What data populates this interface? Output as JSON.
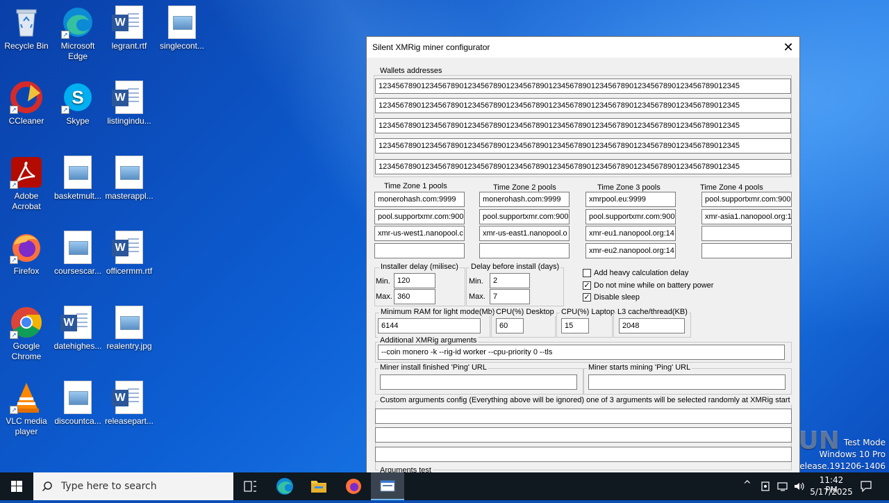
{
  "desktop_icons": [
    {
      "label": "Recycle Bin",
      "icon": "recycle-bin-icon"
    },
    {
      "label": "Microsoft Edge",
      "icon": "edge-icon"
    },
    {
      "label": "legrant.rtf",
      "icon": "word-doc-icon"
    },
    {
      "label": "singlecont...",
      "icon": "image-file-icon"
    },
    {
      "label": "CCleaner",
      "icon": "ccleaner-icon"
    },
    {
      "label": "Skype",
      "icon": "skype-icon"
    },
    {
      "label": "listingindu...",
      "icon": "word-doc-icon"
    },
    {
      "label": "Adobe Acrobat",
      "icon": "acrobat-icon"
    },
    {
      "label": "basketmult...",
      "icon": "image-file-icon"
    },
    {
      "label": "masterappl...",
      "icon": "image-file-icon"
    },
    {
      "label": "Firefox",
      "icon": "firefox-icon"
    },
    {
      "label": "coursescar...",
      "icon": "image-file-icon"
    },
    {
      "label": "officermm.rtf",
      "icon": "word-doc-icon"
    },
    {
      "label": "Google Chrome",
      "icon": "chrome-icon"
    },
    {
      "label": "datehighes...",
      "icon": "word-doc-icon"
    },
    {
      "label": "realentry.jpg",
      "icon": "image-file-icon"
    },
    {
      "label": "VLC media player",
      "icon": "vlc-icon"
    },
    {
      "label": "discountca...",
      "icon": "image-file-icon"
    },
    {
      "label": "releasepart...",
      "icon": "word-doc-icon"
    }
  ],
  "window": {
    "title": "Silent XMRig miner configurator",
    "close_glyph": "✕",
    "wallets": {
      "legend": "Wallets addresses",
      "values": [
        "1234567890123456789012345678901234567890123456789012345678901234567890123456789012345",
        "1234567890123456789012345678901234567890123456789012345678901234567890123456789012345",
        "1234567890123456789012345678901234567890123456789012345678901234567890123456789012345",
        "1234567890123456789012345678901234567890123456789012345678901234567890123456789012345",
        "1234567890123456789012345678901234567890123456789012345678901234567890123456789012345"
      ]
    },
    "pools": [
      {
        "label": "Time Zone 1 pools",
        "values": [
          "monerohash.com:9999",
          "pool.supportxmr.com:900",
          "xmr-us-west1.nanopool.c",
          ""
        ]
      },
      {
        "label": "Time Zone 2 pools",
        "values": [
          "monerohash.com:9999",
          "pool.supportxmr.com:900",
          "xmr-us-east1.nanopool.o",
          ""
        ]
      },
      {
        "label": "Time Zone 3 pools",
        "values": [
          "xmrpool.eu:9999",
          "pool.supportxmr.com:900",
          "xmr-eu1.nanopool.org:14",
          "xmr-eu2.nanopool.org:14"
        ]
      },
      {
        "label": "Time Zone 4 pools",
        "values": [
          "pool.supportxmr.com:900",
          "xmr-asia1.nanopool.org:1",
          "",
          ""
        ]
      }
    ],
    "installer_delay": {
      "legend": "Installer delay (milisec)",
      "min_label": "Min.",
      "min": "120",
      "max_label": "Max.",
      "max": "360"
    },
    "delay_install": {
      "legend": "Delay before install (days)",
      "min_label": "Min.",
      "min": "2",
      "max_label": "Max.",
      "max": "7"
    },
    "checkboxes": [
      {
        "label": "Add heavy calculation delay",
        "mark": ""
      },
      {
        "label": "Do not mine while on battery power",
        "mark": "✓"
      },
      {
        "label": "Disable sleep",
        "mark": "✓"
      }
    ],
    "ram": {
      "legend": "Minimum RAM for light mode(Mb)",
      "value": "6144"
    },
    "cpu_desktop": {
      "legend": "CPU(%) Desktop",
      "value": "60"
    },
    "cpu_laptop": {
      "legend": "CPU(%) Laptop",
      "value": "15"
    },
    "l3": {
      "legend": "L3 cache/thread(KB)",
      "value": "2048"
    },
    "additional": {
      "legend": "Additional XMRig arguments",
      "value": "--coin monero -k --rig-id worker --cpu-priority 0 --tls"
    },
    "ping_install": {
      "legend": "Miner install finished 'Ping' URL",
      "value": ""
    },
    "ping_mining": {
      "legend": "Miner starts mining 'Ping' URL",
      "value": ""
    },
    "custom": {
      "legend": "Custom arguments config (Everything above will be ignored) one of 3 arguments will be selected randomly at XMRig start",
      "values": [
        "",
        "",
        ""
      ]
    },
    "args_test": {
      "legend": "Arguments test"
    }
  },
  "taskbar": {
    "search_placeholder": "Type here to search",
    "time": "11:42 PM",
    "date": "5/17/2025",
    "chevron": "^"
  },
  "watermark": {
    "brand": "ANY.RUN",
    "line1": "Test Mode",
    "line2": "Windows 10 Pro",
    "line3": "vb_release.191206-1406"
  },
  "colors": {
    "accent": "#0078d7",
    "taskbar": "#101820",
    "window_bg": "#f0f0f0"
  }
}
